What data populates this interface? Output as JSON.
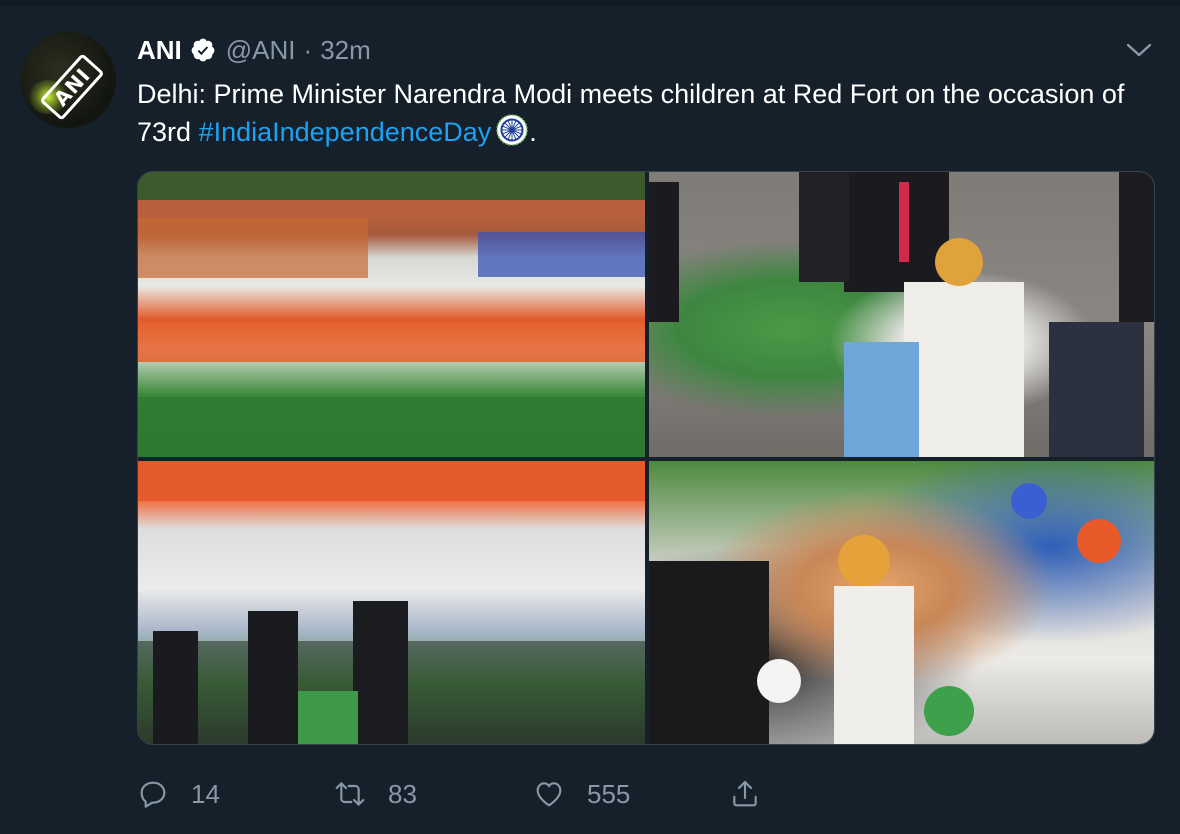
{
  "tweet": {
    "author_name": "ANI",
    "handle": "@ANI",
    "separator": "·",
    "time": "32m",
    "text_prefix": "Delhi: Prime Minister Narendra Modi meets children at Red Fort on the occasion of 73rd ",
    "hashtag": "#IndiaIndependenceDay",
    "text_suffix": ".",
    "avatar_text": "ANI",
    "icons": {
      "verified": "verified-badge-icon",
      "caret": "chevron-down-icon",
      "emoji": "dharma-chakra-emoji"
    }
  },
  "actions": {
    "reply_count": "14",
    "retweet_count": "83",
    "like_count": "555",
    "icons": [
      "reply-icon",
      "retweet-icon",
      "like-icon",
      "share-icon"
    ]
  },
  "colors": {
    "background": "#15202b",
    "text": "#ffffff",
    "muted": "#8899a6",
    "link": "#1da1f2"
  }
}
